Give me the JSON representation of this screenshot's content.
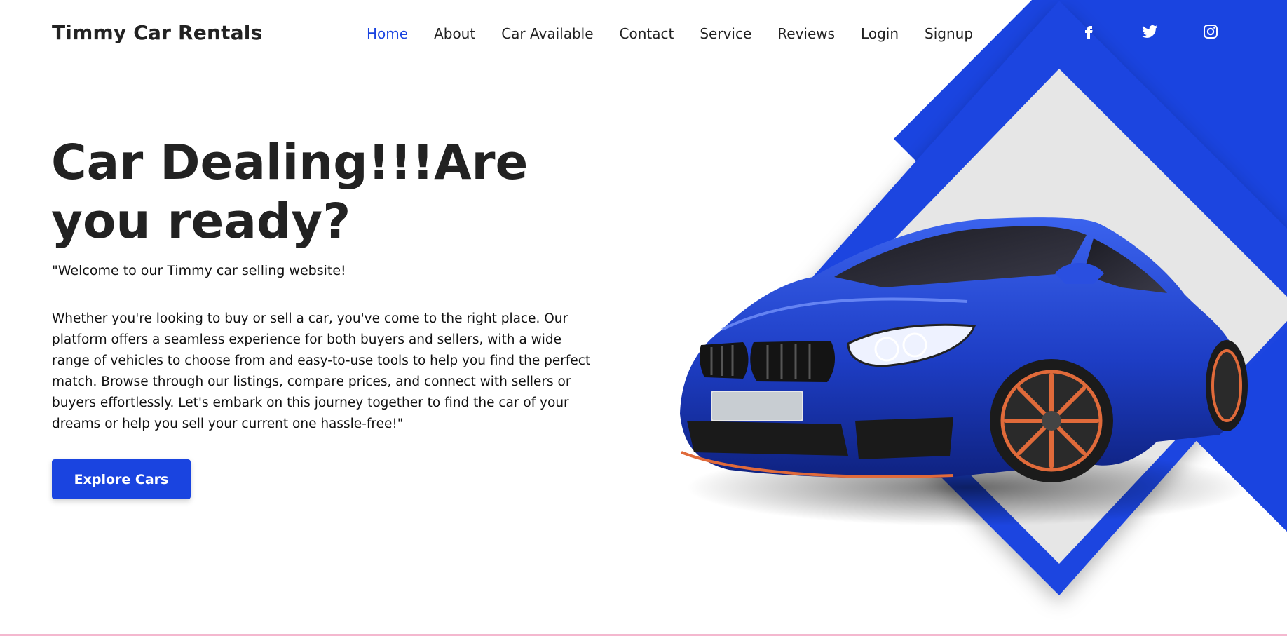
{
  "header": {
    "brand": "Timmy Car Rentals",
    "nav": [
      {
        "label": "Home",
        "active": true
      },
      {
        "label": "About"
      },
      {
        "label": "Car Available"
      },
      {
        "label": "Contact"
      },
      {
        "label": "Service"
      },
      {
        "label": "Reviews"
      },
      {
        "label": "Login"
      },
      {
        "label": "Signup"
      }
    ],
    "social": [
      "facebook-icon",
      "twitter-icon",
      "instagram-icon"
    ]
  },
  "hero": {
    "title": "Car Dealing!!!Are you ready?",
    "welcome": "\"Welcome to our Timmy car selling website!",
    "body": "Whether you're looking to buy or sell a car, you've come to the right place. Our platform offers a seamless experience for both buyers and sellers, with a wide range of vehicles to choose from and easy-to-use tools to help you find the perfect match. Browse through our listings, compare prices, and connect with sellers or buyers effortlessly. Let's embark on this journey together to find the car of your dreams or help you sell your current one hassle-free!\"",
    "cta_label": "Explore Cars"
  },
  "colors": {
    "accent": "#1a44e0",
    "diamond_fill": "#e6e6e6",
    "car_body": "#1f3fc8",
    "rims": "#e06a3a"
  }
}
